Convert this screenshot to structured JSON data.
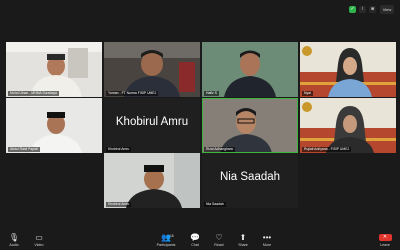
{
  "top_icons": [
    "shield-check-icon",
    "info-icon",
    "lock-icon"
  ],
  "view_label": "View",
  "tiles": [
    {
      "name": "Mohd Ulnan - MHMA Surabaya",
      "big": ""
    },
    {
      "name": "Yuman - FT Nurma FISIP UMEJ",
      "big": ""
    },
    {
      "name": "Hafiz S",
      "big": ""
    },
    {
      "name": "Nyai",
      "big": ""
    },
    {
      "name": "Abdul Rasil Papati",
      "big": ""
    },
    {
      "name": "Khobirul Amru",
      "big": "Khobirul Amru"
    },
    {
      "name": "Rizal Adhanghara",
      "big": ""
    },
    {
      "name": "Rujiati Adriyana - FISIP UMEJ",
      "big": ""
    },
    {
      "name": "Khobirul Amru",
      "big": ""
    },
    {
      "name": "Nia Saadah",
      "big": "Nia Saadah"
    }
  ],
  "toolbar": {
    "audio": "Audio",
    "video": "Video",
    "participants": "Participants",
    "participants_count": "16",
    "chat": "Chat",
    "react": "React",
    "share": "Share",
    "more": "More",
    "leave": "Leave"
  }
}
